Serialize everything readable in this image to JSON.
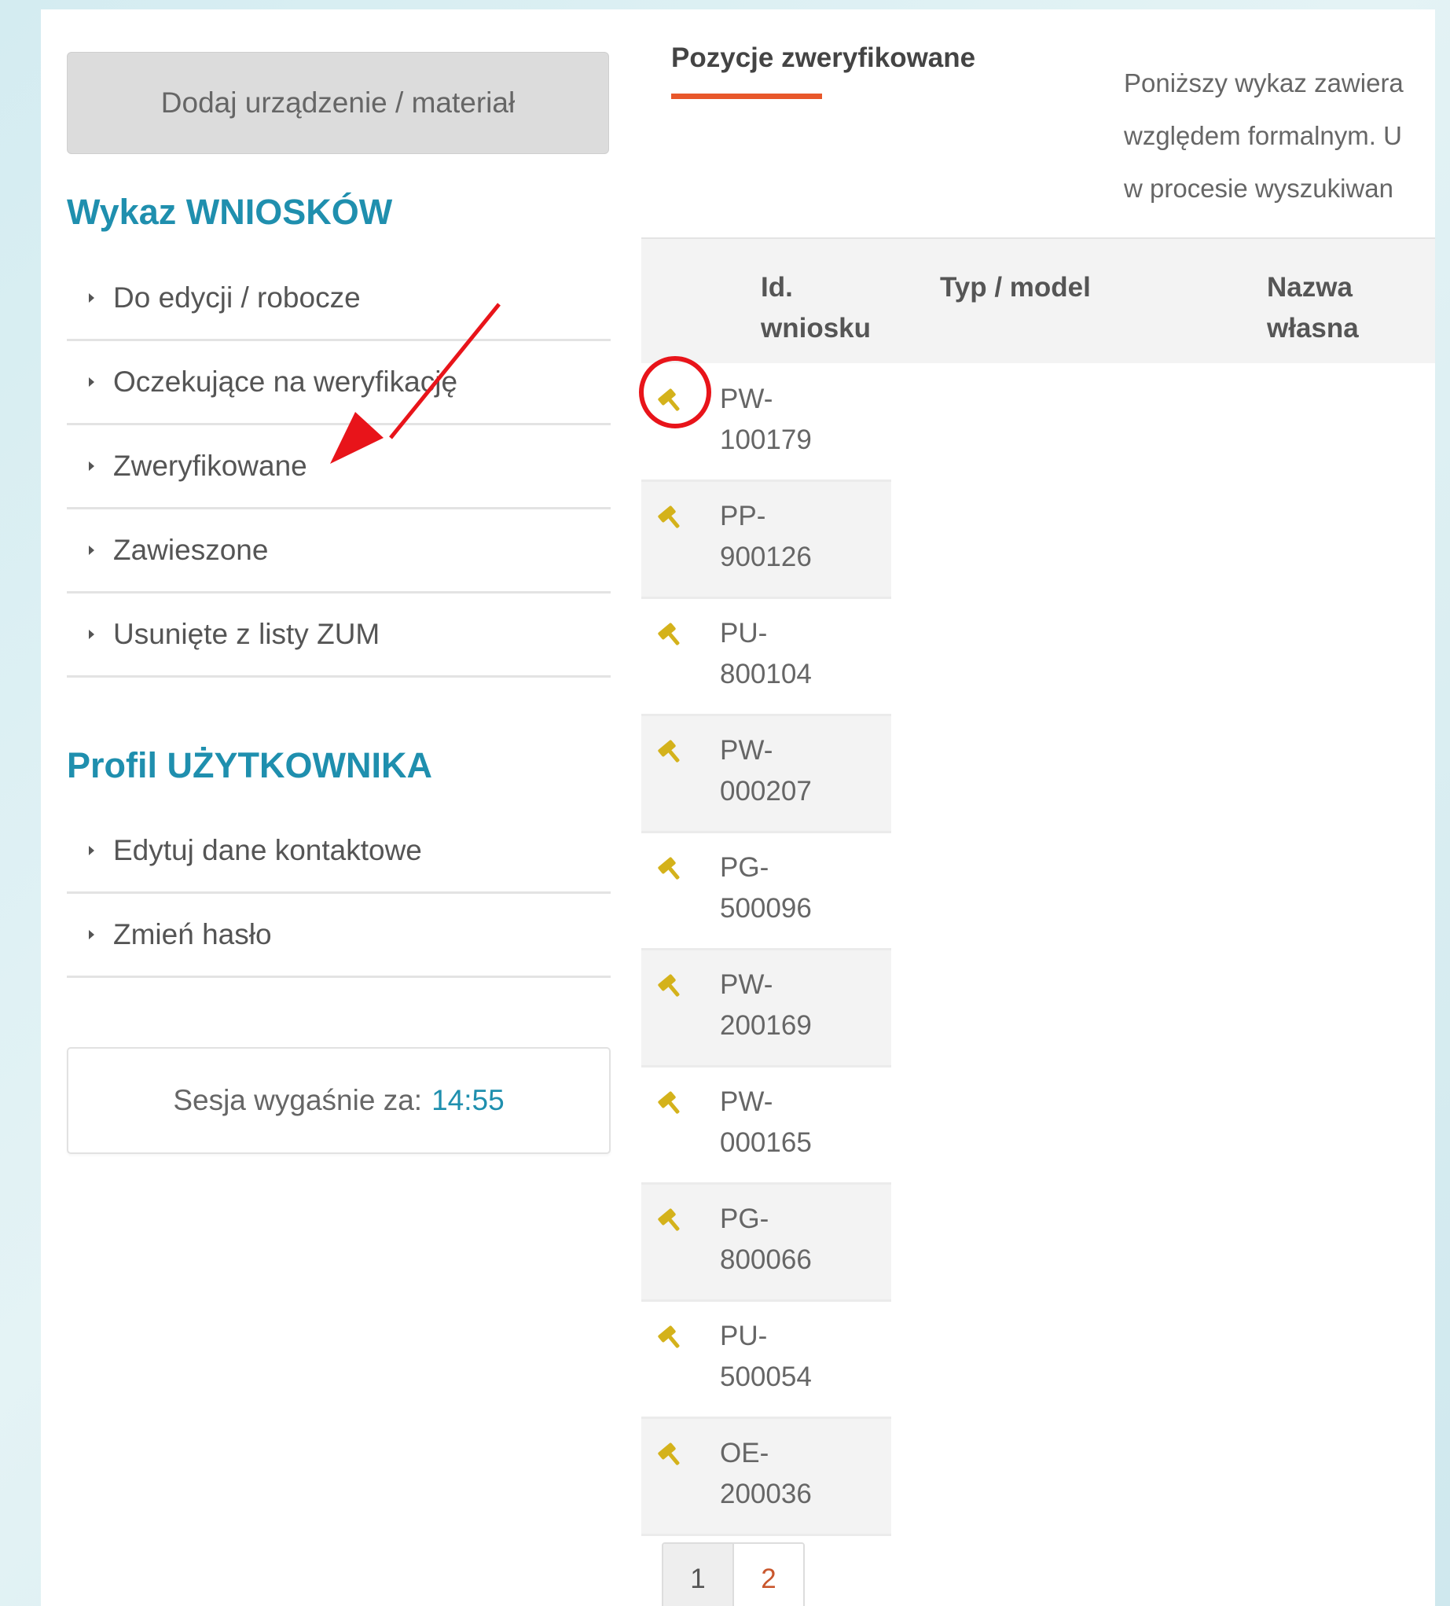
{
  "sidebar": {
    "add_button": "Dodaj urządzenie / materiał",
    "applications_heading": "Wykaz WNIOSKÓW",
    "applications_items": [
      {
        "label": "Do edycji / robocze"
      },
      {
        "label": "Oczekujące na weryfikację"
      },
      {
        "label": "Zweryfikowane"
      },
      {
        "label": "Zawieszone"
      },
      {
        "label": "Usunięte z listy ZUM"
      }
    ],
    "profile_heading": "Profil UŻYTKOWNIKA",
    "profile_items": [
      {
        "label": "Edytuj dane kontaktowe"
      },
      {
        "label": "Zmień hasło"
      }
    ],
    "session_label": "Sesja wygaśnie za:",
    "session_time": "14:55"
  },
  "main": {
    "tab_label": "Pozycje zweryfikowane",
    "description_lines": [
      "Poniższy wykaz zawiera",
      "względem formalnym. U",
      "w procesie wyszukiwan"
    ],
    "table": {
      "columns": [
        {
          "line1": "Id.",
          "line2": "wniosku"
        },
        {
          "line1": "Typ / model",
          "line2": ""
        },
        {
          "line1": "Nazwa własna",
          "line2": ""
        }
      ],
      "rows": [
        {
          "prefix": "PW-",
          "number": "100179"
        },
        {
          "prefix": "PP-",
          "number": "900126"
        },
        {
          "prefix": "PU-",
          "number": "800104"
        },
        {
          "prefix": "PW-",
          "number": "000207"
        },
        {
          "prefix": "PG-",
          "number": "500096"
        },
        {
          "prefix": "PW-",
          "number": "200169"
        },
        {
          "prefix": "PW-",
          "number": "000165"
        },
        {
          "prefix": "PG-",
          "number": "800066"
        },
        {
          "prefix": "PU-",
          "number": "500054"
        },
        {
          "prefix": "OE-",
          "number": "200036"
        }
      ],
      "row_icon": "gavel-icon"
    },
    "pagination": {
      "pages": [
        "1",
        "2"
      ],
      "current": "1"
    }
  },
  "colors": {
    "accent_teal": "#1f8fae",
    "tab_underline": "#e8572a",
    "icon_gold": "#d4b21b",
    "annotation_red": "#e8141a"
  }
}
